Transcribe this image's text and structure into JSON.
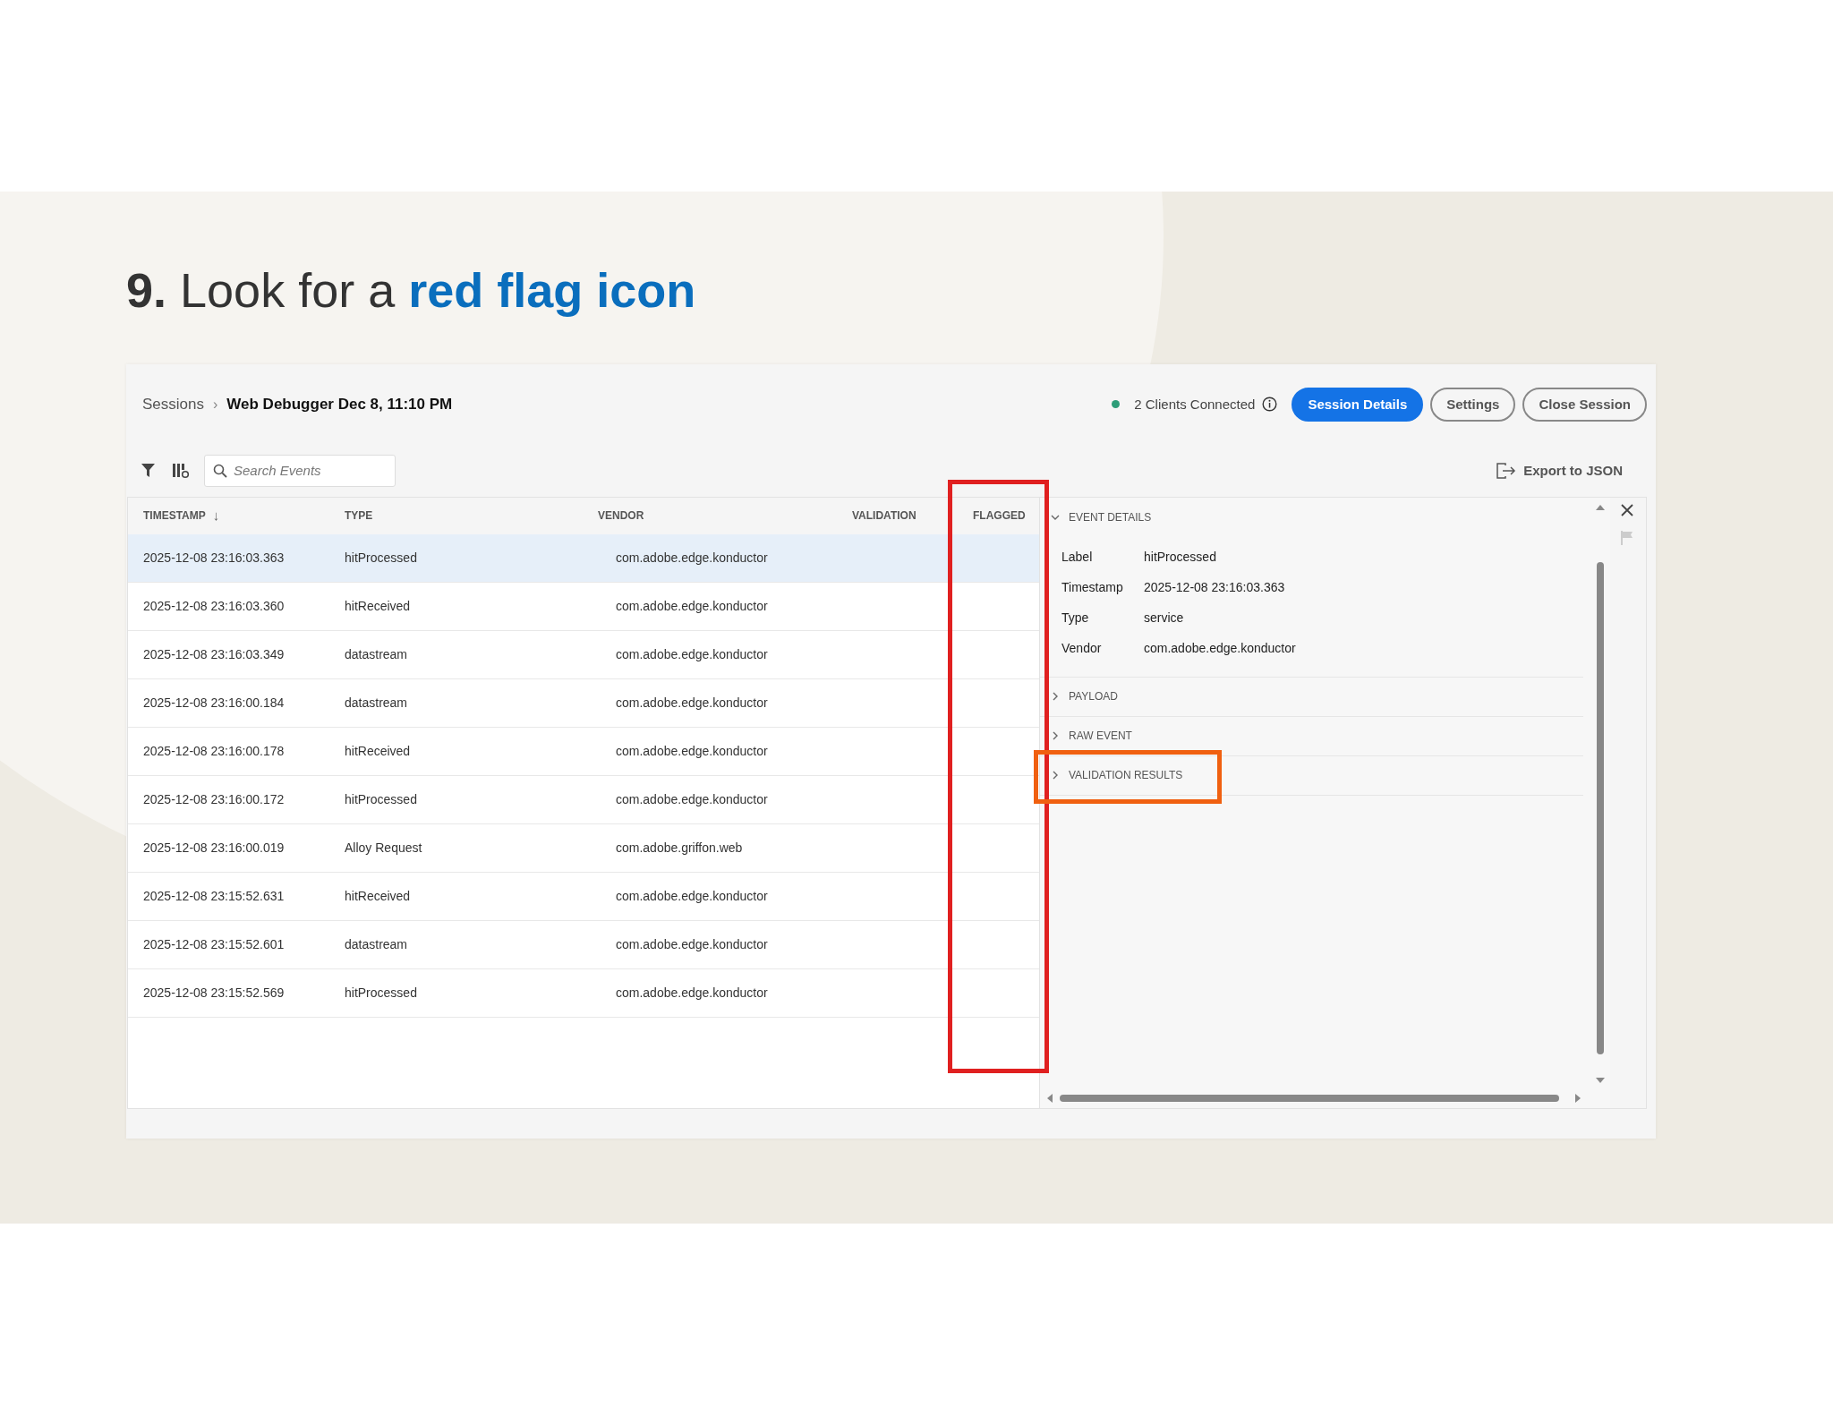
{
  "slide_title": "**9.** Look for a **red flag icon**",
  "breadcrumb": {
    "parent": "Sessions",
    "separator": "›",
    "current": "Web Debugger Dec 8, 11:10 PM"
  },
  "connection": {
    "text": "2 Clients Connected",
    "color": "#2d9d78"
  },
  "buttons": [
    {
      "label": "Session Details",
      "kind": "primary"
    },
    {
      "label": "Settings",
      "kind": "outline"
    },
    {
      "label": "Close Session",
      "kind": "outline"
    }
  ],
  "search": {
    "placeholder": "Search Events"
  },
  "export": {
    "label": "Export to JSON"
  },
  "table": {
    "columns": [
      {
        "label": "TIMESTAMP",
        "sort_mark": "↓"
      },
      {
        "label": "TYPE"
      },
      {
        "label": "VENDOR"
      },
      {
        "label": "VALIDATION"
      },
      {
        "label": "FLAGGED"
      }
    ],
    "rows": [
      {
        "timestamp": "2025-12-08 23:16:03.363",
        "type": "hitProcessed",
        "vendor": "com.adobe.edge.konductor",
        "selected": true
      },
      {
        "timestamp": "2025-12-08 23:16:03.360",
        "type": "hitReceived",
        "vendor": "com.adobe.edge.konductor",
        "selected": false
      },
      {
        "timestamp": "2025-12-08 23:16:03.349",
        "type": "datastream",
        "vendor": "com.adobe.edge.konductor",
        "selected": false
      },
      {
        "timestamp": "2025-12-08 23:16:00.184",
        "type": "datastream",
        "vendor": "com.adobe.edge.konductor",
        "selected": false
      },
      {
        "timestamp": "2025-12-08 23:16:00.178",
        "type": "hitReceived",
        "vendor": "com.adobe.edge.konductor",
        "selected": false
      },
      {
        "timestamp": "2025-12-08 23:16:00.172",
        "type": "hitProcessed",
        "vendor": "com.adobe.edge.konductor",
        "selected": false
      },
      {
        "timestamp": "2025-12-08 23:16:00.019",
        "type": "Alloy Request",
        "vendor": "com.adobe.griffon.web",
        "selected": false
      },
      {
        "timestamp": "2025-12-08 23:15:52.631",
        "type": "hitReceived",
        "vendor": "com.adobe.edge.konductor",
        "selected": false
      },
      {
        "timestamp": "2025-12-08 23:15:52.601",
        "type": "datastream",
        "vendor": "com.adobe.edge.konductor",
        "selected": false
      },
      {
        "timestamp": "2025-12-08 23:15:52.569",
        "type": "hitProcessed",
        "vendor": "com.adobe.edge.konductor",
        "selected": false
      }
    ]
  },
  "details": {
    "sections": [
      {
        "title": "EVENT DETAILS",
        "expanded": true,
        "fields": [
          {
            "label": "Label",
            "value": "hitProcessed"
          },
          {
            "label": "Timestamp",
            "value": "2025-12-08 23:16:03.363"
          },
          {
            "label": "Type",
            "value": "service"
          },
          {
            "label": "Vendor",
            "value": "com.adobe.edge.konductor"
          }
        ]
      },
      {
        "title": "PAYLOAD",
        "expanded": false
      },
      {
        "title": "RAW EVENT",
        "expanded": false
      },
      {
        "title": "VALIDATION RESULTS",
        "expanded": false
      }
    ]
  },
  "annotations": [
    {
      "kind": "column_frame",
      "color": "#e02020"
    },
    {
      "kind": "section_frame",
      "color": "#f06010"
    }
  ]
}
